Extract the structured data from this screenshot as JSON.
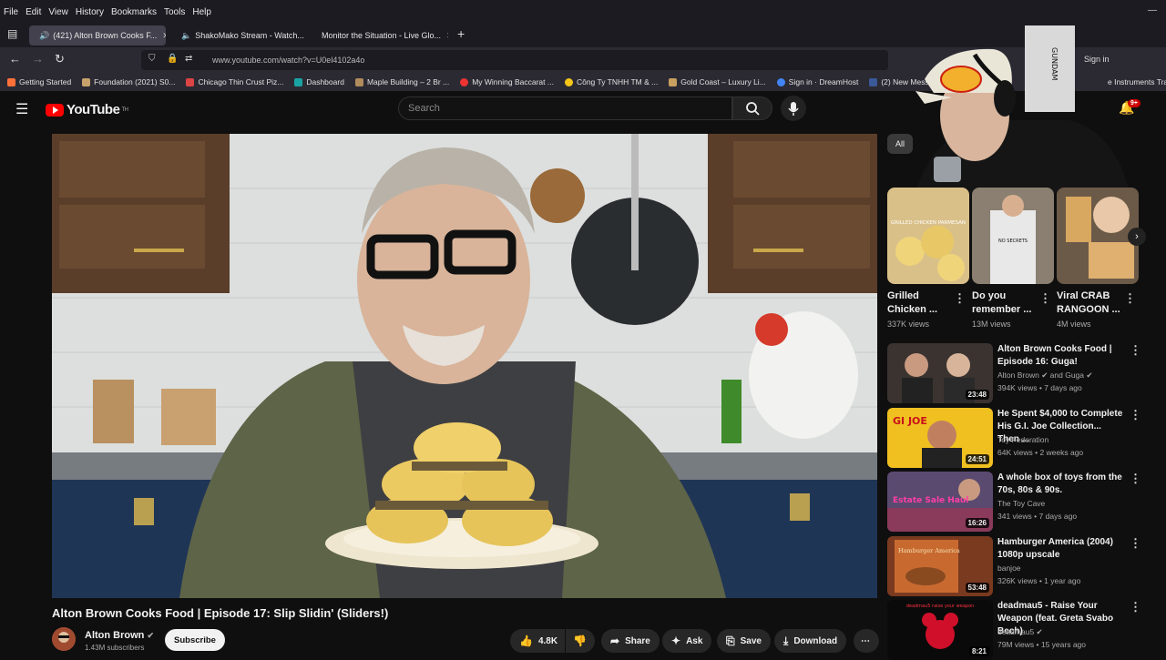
{
  "menubar": [
    "File",
    "Edit",
    "View",
    "History",
    "Bookmarks",
    "Tools",
    "Help"
  ],
  "tabs": [
    {
      "label": "(421) Alton Brown Cooks F..."
    },
    {
      "label": "ShakoMako Stream - Watch..."
    },
    {
      "label": "Monitor the Situation - Live Glo..."
    }
  ],
  "nav": {
    "url": "www.youtube.com/watch?v=U0el4102a4o",
    "signin": "Sign in"
  },
  "bookmarks": [
    "Getting Started",
    "Foundation (2021) S0...",
    "Chicago Thin Crust Piz...",
    "Dashboard",
    "Maple Building – 2 Br ...",
    "My Winning Baccarat ...",
    "Công Ty TNHH TM & ...",
    "Gold Coast – Luxury Li...",
    "Sign in · DreamHost",
    "(2) New Message!",
    "e Instruments Tra"
  ],
  "yt": {
    "logo": "YouTube",
    "logo_sup": "TH",
    "search_placeholder": "Search",
    "notif_badge": "9+"
  },
  "video": {
    "title": "Alton Brown Cooks Food | Episode 17: Slip Slidin' (Sliders!)",
    "channel": "Alton Brown",
    "subs": "1.43M subscribers",
    "subscribe": "Subscribe",
    "likes": "4.8K",
    "share": "Share",
    "ask": "Ask",
    "save": "Save",
    "download": "Download"
  },
  "chips": {
    "all": "All"
  },
  "shorts": [
    {
      "title": "Grilled Chicken ...",
      "views": "337K views",
      "thumb_text": "GRILLED CHICKEN PARMESAN"
    },
    {
      "title": "Do you remember ...",
      "views": "13M views",
      "thumb_text": "NO SECRETS"
    },
    {
      "title": "Viral CRAB RANGOON ...",
      "views": "4M views",
      "thumb_text": ""
    }
  ],
  "recs": [
    {
      "title": "Alton Brown Cooks Food | Episode 16: Guga!",
      "channel": "Alton Brown ✔ and Guga ✔",
      "meta": "394K views • 7 days ago",
      "duration": "23:48",
      "thumb_text": ""
    },
    {
      "title": "He Spent $4,000 to Complete His G.I. Joe Collection... Then ...",
      "channel": "Toy Federation",
      "meta": "64K views • 2 weeks ago",
      "duration": "24:51",
      "thumb_text": "GI JOE"
    },
    {
      "title": "A whole box of toys from the 70s, 80s & 90s.",
      "channel": "The Toy Cave",
      "meta": "341 views • 7 days ago",
      "duration": "16:26",
      "thumb_text": "Estate Sale Haul"
    },
    {
      "title": "Hamburger America (2004) 1080p upscale",
      "channel": "banjoe",
      "meta": "326K views • 1 year ago",
      "duration": "53:48",
      "thumb_text": "Hamburger America"
    },
    {
      "title": "deadmau5 - Raise Your Weapon (feat. Greta Svabo Bech)",
      "channel": "deadmau5 ✔",
      "meta": "79M views • 15 years ago",
      "duration": "8:21",
      "thumb_text": "deadmau5 raise your weapon"
    }
  ],
  "webcam": {
    "shirt_text": "GUNDAM"
  }
}
